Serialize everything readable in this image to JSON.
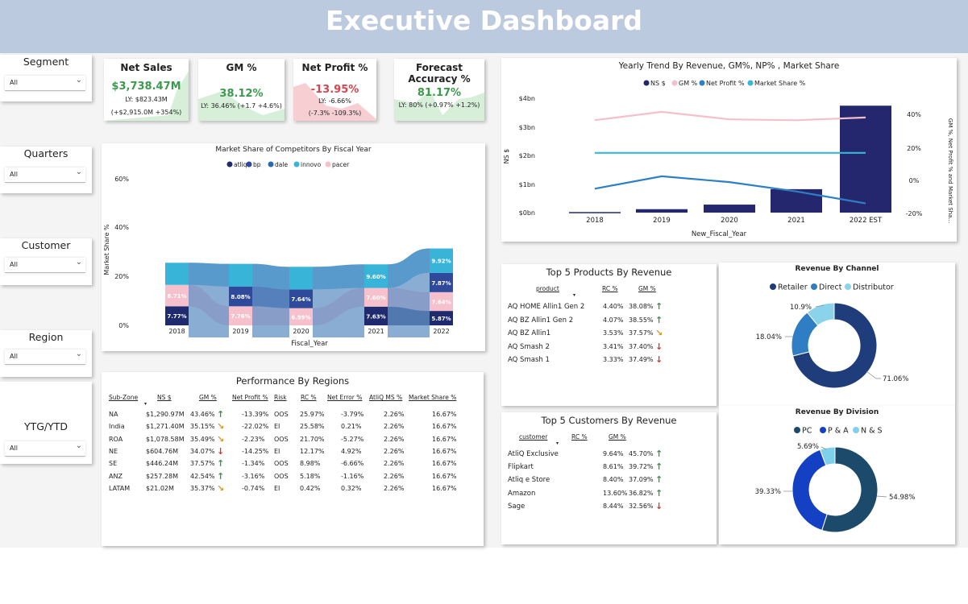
{
  "header": {
    "title": "Executive Dashboard"
  },
  "slicers": [
    {
      "label": "Segment",
      "value": "All"
    },
    {
      "label": "Quarters",
      "value": "All"
    },
    {
      "label": "Customer",
      "value": "All"
    },
    {
      "label": "Region",
      "value": "All"
    },
    {
      "label": "YTG/YTD",
      "value": "All"
    }
  ],
  "kpis": [
    {
      "title": "Net Sales",
      "value": "$3,738.47M",
      "ly": "LY: $823.43M",
      "change": "(+$2,915.0M +354%)",
      "color": "#3c9a4e"
    },
    {
      "title": "GM %",
      "value": "38.12%",
      "ly": "LY: 36.46% (+1.7 +4.6%)",
      "change": "",
      "color": "#3c9a4e"
    },
    {
      "title": "Net Profit %",
      "value": "-13.95%",
      "ly": "LY: -6.66%",
      "change": "(-7.3% -109.3%)",
      "color": "#d8454f"
    },
    {
      "title": "Forecast Accuracy %",
      "value": "81.17%",
      "ly": "LY: 80% (+0.97% +1.2%)",
      "change": "",
      "color": "#3c9a4e"
    }
  ],
  "competitors": {
    "title": "Market Share of Competitors By Fiscal Year",
    "ylabel": "Market Share %",
    "xlabel": "Fiscal_Year",
    "legend": [
      "atliq",
      "bp",
      "dale",
      "innovo",
      "pacer"
    ],
    "ticks": [
      "60%",
      "40%",
      "20%",
      "0%"
    ]
  },
  "yearly": {
    "title": "Yearly Trend By Revenue, GM%, NP% , Market Share",
    "legend": [
      "NS $",
      "GM %",
      "Net Profit %",
      "Market Share %"
    ],
    "ylabel_left": "NS $",
    "ylabel_right": "GM %, Net Profit % and Market Sha...",
    "xlabel": "New_Fiscal_Year",
    "left_ticks": [
      "$4bn",
      "$3bn",
      "$2bn",
      "$1bn",
      "$0bn"
    ],
    "right_ticks": [
      "40%",
      "20%",
      "0%",
      "-20%"
    ]
  },
  "regions": {
    "title": "Performance By Regions",
    "columns": [
      "Sub-Zone",
      "NS $",
      "GM %",
      "Net Profit %",
      "Risk",
      "RC %",
      "Net Error %",
      "AtliQ MS %",
      "Market Share %"
    ],
    "rows": [
      [
        "NA",
        "$1,290.97M",
        "43.46%",
        "up",
        "-13.39%",
        "OOS",
        "25.97%",
        "-3.79%",
        "2.26%",
        "16.67%"
      ],
      [
        "India",
        "$1,271.40M",
        "35.15%",
        "side",
        "-22.02%",
        "EI",
        "25.58%",
        "0.21%",
        "2.26%",
        "16.67%"
      ],
      [
        "ROA",
        "$1,078.58M",
        "35.49%",
        "side",
        "-2.23%",
        "OOS",
        "21.70%",
        "-5.27%",
        "2.26%",
        "16.67%"
      ],
      [
        "NE",
        "$604.76M",
        "34.07%",
        "down",
        "-14.25%",
        "EI",
        "12.17%",
        "4.92%",
        "2.26%",
        "16.67%"
      ],
      [
        "SE",
        "$446.24M",
        "37.57%",
        "up",
        "-1.34%",
        "OOS",
        "8.98%",
        "-6.66%",
        "2.26%",
        "16.67%"
      ],
      [
        "ANZ",
        "$257.28M",
        "42.54%",
        "up",
        "-3.16%",
        "OOS",
        "5.18%",
        "-1.16%",
        "2.26%",
        "16.67%"
      ],
      [
        "LATAM",
        "$21.02M",
        "35.37%",
        "side",
        "-0.74%",
        "EI",
        "0.42%",
        "0.32%",
        "2.26%",
        "16.67%"
      ]
    ]
  },
  "products": {
    "title": "Top 5 Products By Revenue",
    "columns": [
      "product",
      "RC %",
      "GM %"
    ],
    "rows": [
      [
        "AQ HOME Allin1 Gen 2",
        "4.40%",
        "38.08%",
        "up"
      ],
      [
        "AQ BZ Allin1 Gen 2",
        "4.07%",
        "38.55%",
        "up"
      ],
      [
        "AQ BZ Allin1",
        "3.53%",
        "37.57%",
        "side"
      ],
      [
        "AQ Smash 2",
        "3.41%",
        "37.40%",
        "down"
      ],
      [
        "AQ Smash 1",
        "3.33%",
        "37.49%",
        "down"
      ]
    ]
  },
  "customers": {
    "title": "Top 5 Customers By Revenue",
    "columns": [
      "customer",
      "RC %",
      "GM %"
    ],
    "rows": [
      [
        "AtliQ Exclusive",
        "9.64%",
        "45.70%",
        "up"
      ],
      [
        "Flipkart",
        "8.61%",
        "39.72%",
        "up"
      ],
      [
        "Atliq e Store",
        "8.40%",
        "37.09%",
        "up"
      ],
      [
        "Amazon",
        "13.60%",
        "36.82%",
        "up"
      ],
      [
        "Sage",
        "8.44%",
        "32.56%",
        "down"
      ]
    ]
  },
  "channel": {
    "title": "Revenue By Channel",
    "legend": [
      "Retailer",
      "Direct",
      "Distributor"
    ],
    "labels": [
      "71.06%",
      "18.04%",
      "10.9%"
    ]
  },
  "division": {
    "title": "Revenue By Division",
    "legend": [
      "PC",
      "P & A",
      "N & S"
    ],
    "labels": [
      "54.98%",
      "39.33%",
      "5.69%"
    ]
  },
  "chart_data": [
    {
      "type": "bar",
      "title": "Market Share of Competitors By Fiscal Year",
      "xlabel": "Fiscal_Year",
      "ylabel": "Market Share %",
      "categories": [
        "2018",
        "2019",
        "2020",
        "2021",
        "2022"
      ],
      "ylim": [
        0,
        60
      ],
      "series": [
        {
          "name": "atliq",
          "values": [
            7.77,
            0,
            0,
            7.63,
            5.87
          ],
          "labels": [
            "7.77%",
            "",
            "",
            "7.63%",
            "5.87%"
          ],
          "color": "#1f2b6e"
        },
        {
          "name": "bp",
          "values": [
            0,
            8.08,
            7.64,
            0,
            7.87
          ],
          "labels": [
            "",
            "8.08%",
            "7.64%",
            "",
            "7.87%"
          ],
          "color": "#2f4a9a"
        },
        {
          "name": "dale",
          "values": [
            0,
            0,
            0,
            0,
            0
          ],
          "labels": [
            "",
            "",
            "",
            "",
            ""
          ],
          "color": "#2a6ab0"
        },
        {
          "name": "innovo",
          "values": [
            0,
            0,
            0,
            9.6,
            9.92
          ],
          "labels": [
            "",
            "",
            "",
            "9.60%",
            "9.92%"
          ],
          "color": "#37b4d8"
        },
        {
          "name": "pacer",
          "values": [
            8.71,
            7.76,
            6.99,
            7.6,
            7.64
          ],
          "labels": [
            "8.71%",
            "7.76%",
            "6.99%",
            "7.60%",
            "7.64%"
          ],
          "color": "#f6c0cc"
        }
      ]
    },
    {
      "type": "bar",
      "title": "Yearly Trend By Revenue, GM%, NP% , Market Share",
      "xlabel": "New_Fiscal_Year",
      "categories": [
        "2018",
        "2019",
        "2020",
        "2021",
        "2022 EST"
      ],
      "series": [
        {
          "name": "NS $",
          "axis": "left",
          "values": [
            0.02,
            0.12,
            0.28,
            0.82,
            3.74
          ],
          "color": "#24276e"
        },
        {
          "name": "GM %",
          "axis": "right",
          "values": [
            36.5,
            41.5,
            37.0,
            36.46,
            38.12
          ],
          "color": "#f5bfcb"
        },
        {
          "name": "Net Profit %",
          "axis": "right",
          "values": [
            -5.0,
            2.5,
            -1.0,
            -6.66,
            -13.95
          ],
          "color": "#2e7fc4"
        },
        {
          "name": "Market Share %",
          "axis": "right",
          "values": [
            16.67,
            16.67,
            16.67,
            16.67,
            16.67
          ],
          "color": "#36b8d6"
        }
      ],
      "ylim_left": [
        0,
        4
      ],
      "ylim_right": [
        -20,
        50
      ]
    },
    {
      "type": "pie",
      "title": "Revenue By Channel",
      "categories": [
        "Retailer",
        "Direct",
        "Distributor"
      ],
      "values": [
        71.06,
        18.04,
        10.9
      ],
      "colors": [
        "#1f3d7a",
        "#2f7ec3",
        "#8bd3ea"
      ]
    },
    {
      "type": "pie",
      "title": "Revenue By Division",
      "categories": [
        "PC",
        "P & A",
        "N & S"
      ],
      "values": [
        54.98,
        39.33,
        5.69
      ],
      "colors": [
        "#1c4a6a",
        "#1440c4",
        "#7fd0ea"
      ]
    }
  ]
}
